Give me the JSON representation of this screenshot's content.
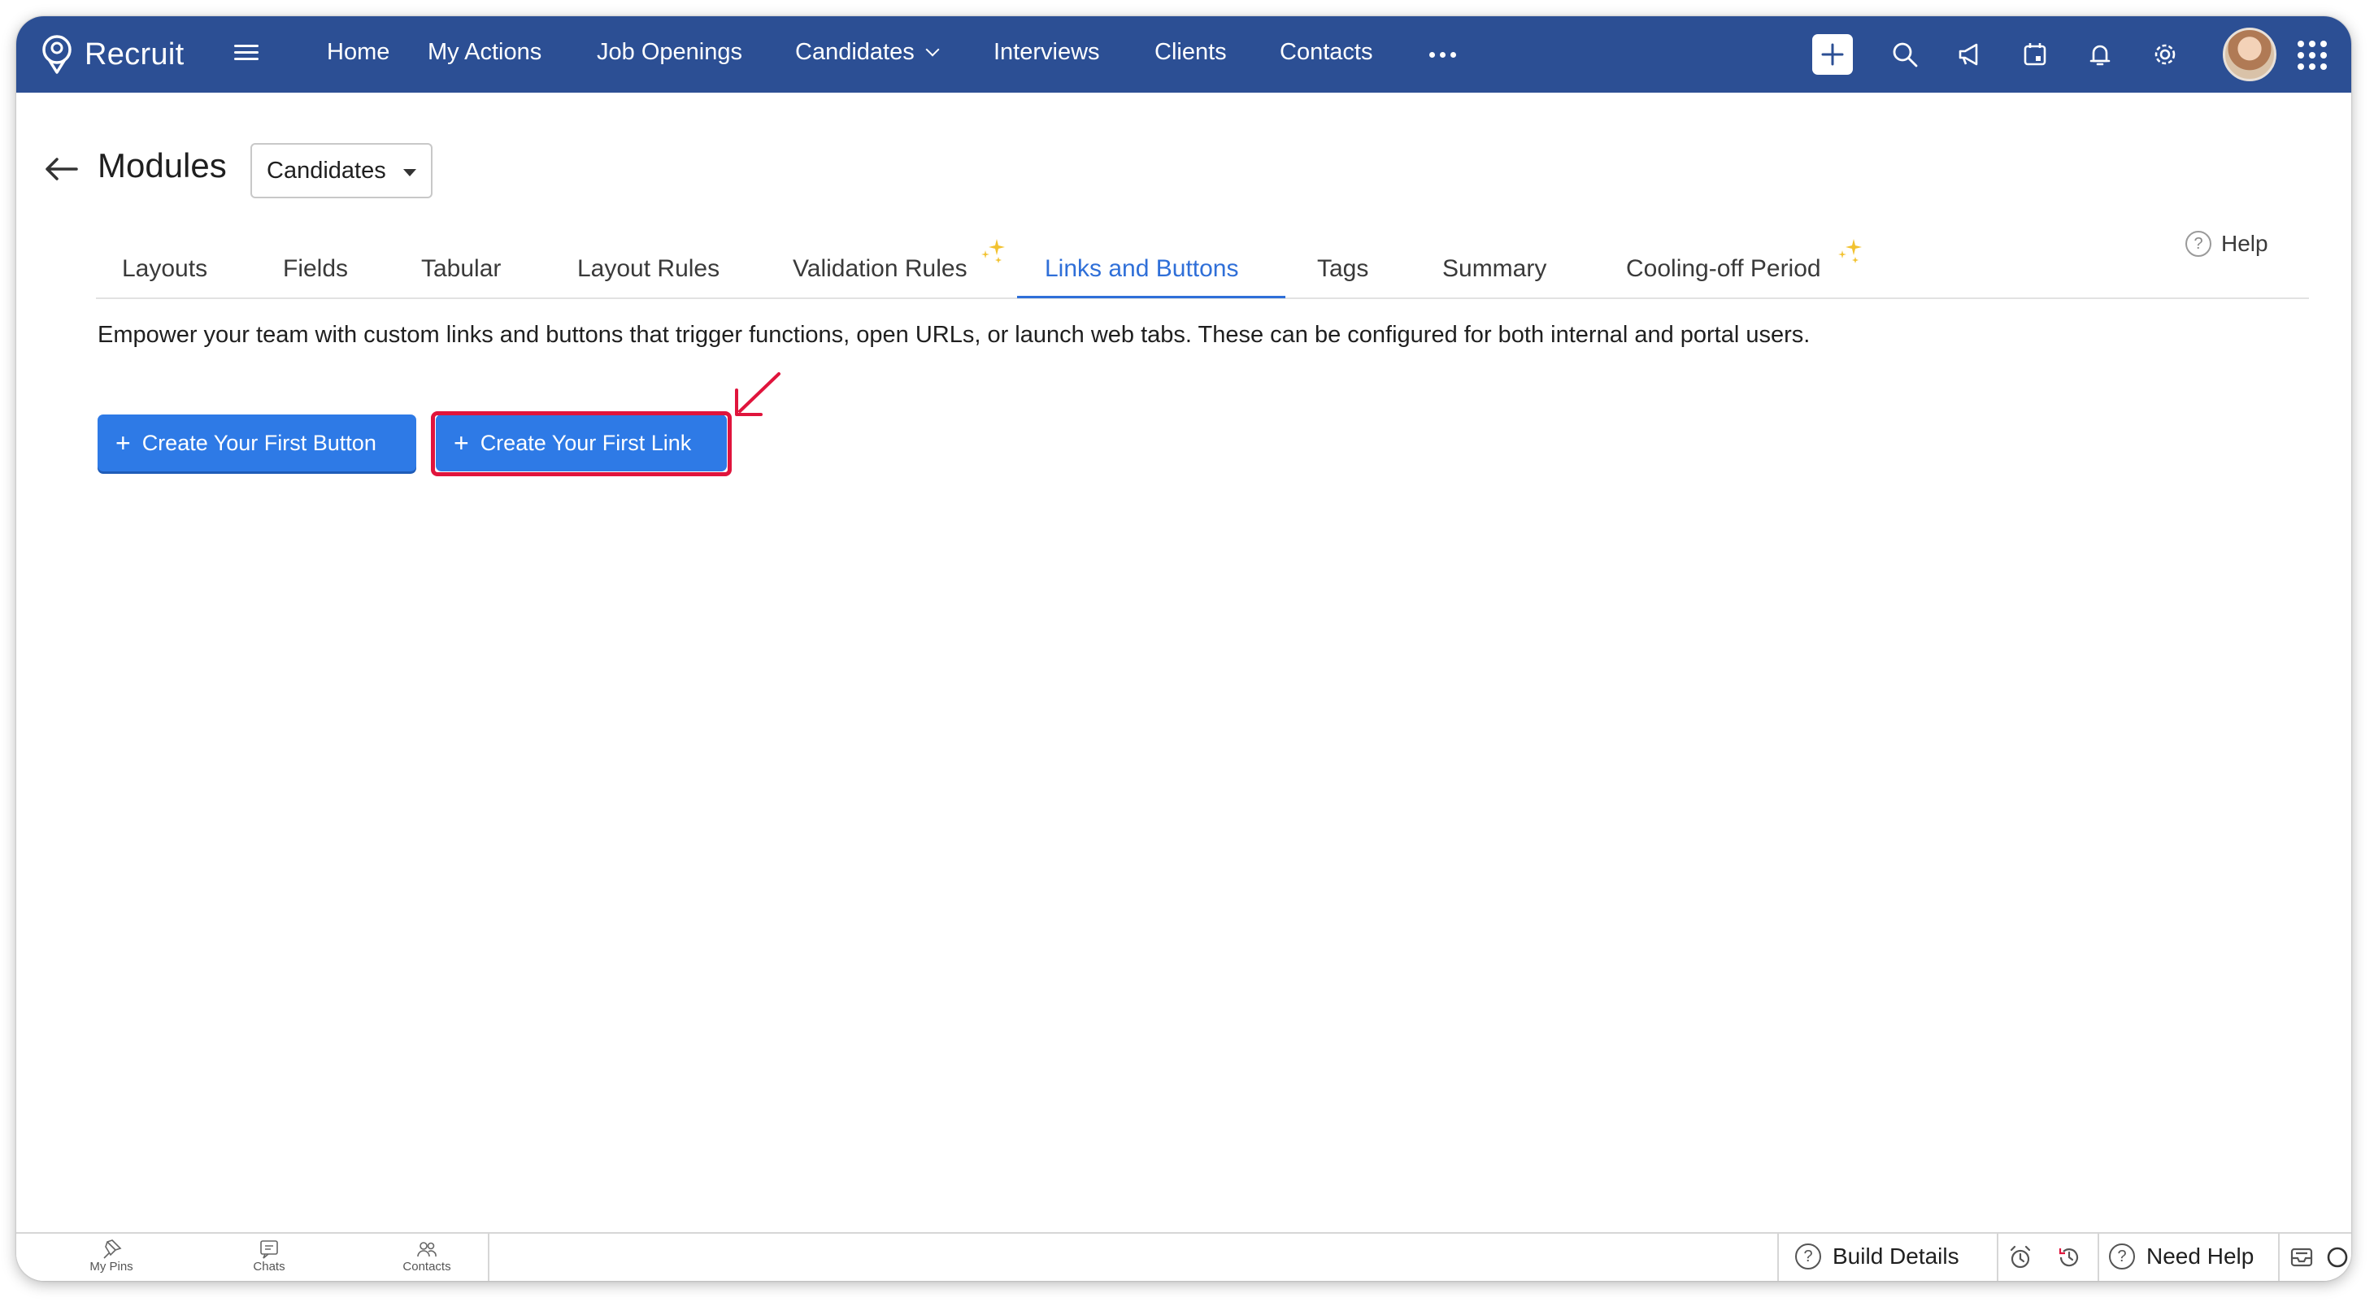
{
  "app": {
    "name": "Recruit"
  },
  "nav": {
    "items": [
      {
        "label": "Home"
      },
      {
        "label": "My Actions"
      },
      {
        "label": "Job Openings"
      },
      {
        "label": "Candidates"
      },
      {
        "label": "Interviews"
      },
      {
        "label": "Clients"
      },
      {
        "label": "Contacts"
      }
    ],
    "more_icon": "more-horizontal-icon"
  },
  "top_icons": [
    "plus-icon",
    "search-icon",
    "announcement-icon",
    "calendar-icon",
    "bell-icon",
    "gear-icon",
    "avatar",
    "apps-grid-icon"
  ],
  "header": {
    "title": "Modules",
    "module_select": {
      "selected": "Candidates"
    }
  },
  "tabs": {
    "items": [
      {
        "label": "Layouts"
      },
      {
        "label": "Fields"
      },
      {
        "label": "Tabular"
      },
      {
        "label": "Layout Rules"
      },
      {
        "label": "Validation Rules"
      },
      {
        "label": "Links and Buttons"
      },
      {
        "label": "Tags"
      },
      {
        "label": "Summary"
      },
      {
        "label": "Cooling-off Period"
      }
    ],
    "active": "Links and Buttons",
    "help_label": "Help"
  },
  "main": {
    "description": "Empower your team with custom links and buttons that trigger functions, open URLs, or launch web tabs. These can be configured for both internal and portal users.",
    "create_button_label": "Create Your First Button",
    "create_link_label": "Create Your First Link"
  },
  "bottombar": {
    "pins_label": "My Pins",
    "chats_label": "Chats",
    "contacts_label": "Contacts",
    "build_details_label": "Build Details",
    "need_help_label": "Need Help"
  },
  "colors": {
    "topbar": "#2c4f94",
    "accent": "#2f6fd8",
    "button": "#2e7ae6",
    "highlight": "#e0143c",
    "sparkle": "#f2c230"
  }
}
